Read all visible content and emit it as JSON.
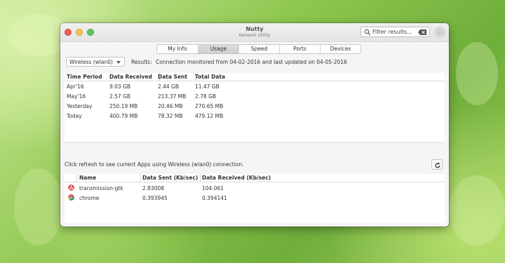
{
  "window": {
    "title": "Nutty",
    "subtitle": "Network Utility"
  },
  "search": {
    "placeholder": "Filter results..."
  },
  "tabs": [
    "My Info",
    "Usage",
    "Speed",
    "Ports",
    "Devices"
  ],
  "active_tab": "Usage",
  "interface_select": {
    "value": "Wireless (wlan0)"
  },
  "results": {
    "label": "Results:",
    "text": "Connection monitored from 04-02-2016 and last updated on 04-05-2016"
  },
  "usage_table": {
    "headers": [
      "Time Period",
      "Data Received",
      "Data Sent",
      "Total Data"
    ],
    "rows": [
      [
        "Apr'16",
        "9.03 GB",
        "2.44 GB",
        "11.47 GB"
      ],
      [
        "May'16",
        "2.57 GB",
        "213.37 MB",
        "2.78 GB"
      ],
      [
        "Yesterday",
        "250.19 MB",
        "20.46 MB",
        "270.65 MB"
      ],
      [
        "Today",
        "400.79 MB",
        "78.32 MB",
        "479.12 MB"
      ]
    ]
  },
  "apps_info": "Click refresh to see current Apps using Wireless (wlan0) connection.",
  "apps_table": {
    "headers": [
      "Name",
      "Data Sent (Kb/sec)",
      "Data Received (Kb/sec)"
    ],
    "rows": [
      {
        "icon": "transmission-icon",
        "name": "transmission-gtk",
        "sent": "2.83008",
        "received": "104.061"
      },
      {
        "icon": "chrome-icon",
        "name": "chrome",
        "sent": "0.393945",
        "received": "0.394141"
      }
    ]
  },
  "colors": {
    "close": "#f25f58",
    "minimize": "#f6c24f",
    "maximize": "#5fc85a",
    "transmission": "#e03a3a",
    "active_tab": "#d4d4d4"
  }
}
